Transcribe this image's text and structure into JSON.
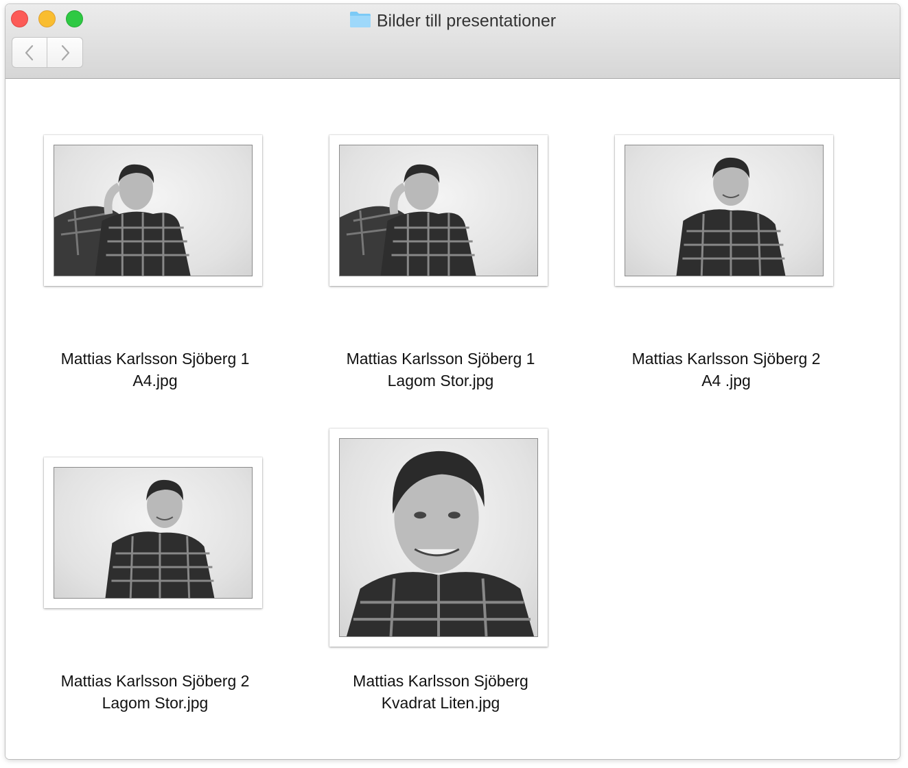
{
  "window": {
    "title": "Bilder till presentationer",
    "title_icon": "folder-icon"
  },
  "toolbar": {
    "back_icon": "chevron-left-icon",
    "forward_icon": "chevron-right-icon"
  },
  "colors": {
    "close": "#fc5b57",
    "minimize": "#f9bd30",
    "zoom": "#2ec943",
    "folder": "#7ccaf6"
  },
  "files": [
    {
      "line1": "Mattias Karlsson Sjöberg 1",
      "line2": "A4.jpg",
      "pose": "hand-on-head"
    },
    {
      "line1": "Mattias Karlsson Sjöberg 1",
      "line2": "Lagom Stor.jpg",
      "pose": "hand-on-head"
    },
    {
      "line1": "Mattias Karlsson Sjöberg 2",
      "line2": "A4 .jpg",
      "pose": "smiling"
    },
    {
      "line1": "Mattias Karlsson Sjöberg 2",
      "line2": "Lagom Stor.jpg",
      "pose": "smiling"
    },
    {
      "line1": "Mattias Karlsson Sjöberg",
      "line2": "Kvadrat Liten.jpg",
      "pose": "close-up"
    }
  ]
}
